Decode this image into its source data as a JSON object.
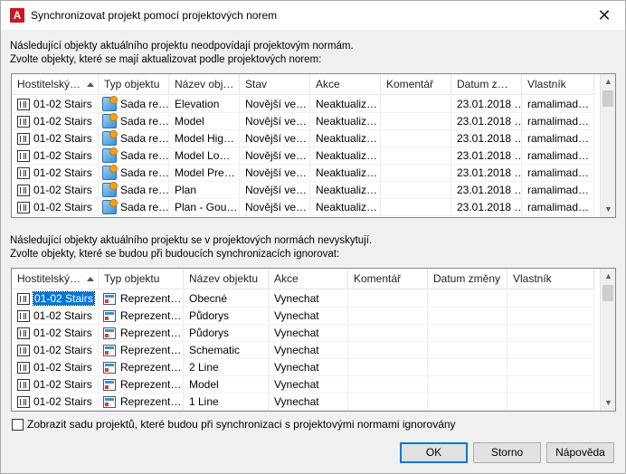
{
  "window": {
    "title": "Synchronizovat projekt pomocí projektových norem",
    "app_icon_letter": "A",
    "close_glyph": "✕"
  },
  "section1": {
    "line1": "Následující objekty aktuálního projektu neodpovídají projektovým normám.",
    "line2": "Zvolte objekty, které se mají aktualizovat podle projektových norem:",
    "columns": [
      "Hostitelský…",
      "Typ objektu",
      "Název obj…",
      "Stav",
      "Akce",
      "Komentář",
      "Datum z…",
      "Vlastník"
    ],
    "rows": [
      [
        "01-02 Stairs",
        "Sada re…",
        "Elevation",
        "Novější ve…",
        "Neaktualiz…",
        "",
        "23.01.2018 …",
        "ramalimad…"
      ],
      [
        "01-02 Stairs",
        "Sada re…",
        "Model",
        "Novější ve…",
        "Neaktualiz…",
        "",
        "23.01.2018 …",
        "ramalimad…"
      ],
      [
        "01-02 Stairs",
        "Sada re…",
        "Model Hig…",
        "Novější ve…",
        "Neaktualiz…",
        "",
        "23.01.2018 …",
        "ramalimad…"
      ],
      [
        "01-02 Stairs",
        "Sada re…",
        "Model Lo…",
        "Novější ve…",
        "Neaktualiz…",
        "",
        "23.01.2018 …",
        "ramalimad…"
      ],
      [
        "01-02 Stairs",
        "Sada re…",
        "Model Pre…",
        "Novější ve…",
        "Neaktualiz…",
        "",
        "23.01.2018 …",
        "ramalimad…"
      ],
      [
        "01-02 Stairs",
        "Sada re…",
        "Plan",
        "Novější ve…",
        "Neaktualiz…",
        "",
        "23.01.2018 …",
        "ramalimad…"
      ],
      [
        "01-02 Stairs",
        "Sada re…",
        "Plan - Gou…",
        "Novější ve…",
        "Neaktualiz…",
        "",
        "23.01.2018 …",
        "ramalimad…"
      ]
    ]
  },
  "section2": {
    "line1": "Následující objekty aktuálního projektu se v projektových normách nevyskytují.",
    "line2": "Zvolte objekty, které se budou při budoucích synchronizacích ignorovat:",
    "columns": [
      "Hostitelský…",
      "Typ objektu",
      "Název objektu",
      "Akce",
      "Komentář",
      "Datum změny",
      "Vlastník"
    ],
    "rows": [
      [
        "01-02 Stairs",
        "Reprezent…",
        "Obecné",
        "Vynechat",
        "",
        "",
        ""
      ],
      [
        "01-02 Stairs",
        "Reprezent…",
        "Půdorys",
        "Vynechat",
        "",
        "",
        ""
      ],
      [
        "01-02 Stairs",
        "Reprezent…",
        "Půdorys",
        "Vynechat",
        "",
        "",
        ""
      ],
      [
        "01-02 Stairs",
        "Reprezent…",
        "Schematic",
        "Vynechat",
        "",
        "",
        ""
      ],
      [
        "01-02 Stairs",
        "Reprezent…",
        "2 Line",
        "Vynechat",
        "",
        "",
        ""
      ],
      [
        "01-02 Stairs",
        "Reprezent…",
        "Model",
        "Vynechat",
        "",
        "",
        ""
      ],
      [
        "01-02 Stairs",
        "Reprezent…",
        "1 Line",
        "Vynechat",
        "",
        "",
        ""
      ]
    ]
  },
  "checkbox": {
    "label": "Zobrazit sadu projektů, které budou při synchronizaci s projektovými normami ignorovány",
    "checked": false
  },
  "buttons": {
    "ok": "OK",
    "cancel": "Storno",
    "help": "Nápověda"
  }
}
